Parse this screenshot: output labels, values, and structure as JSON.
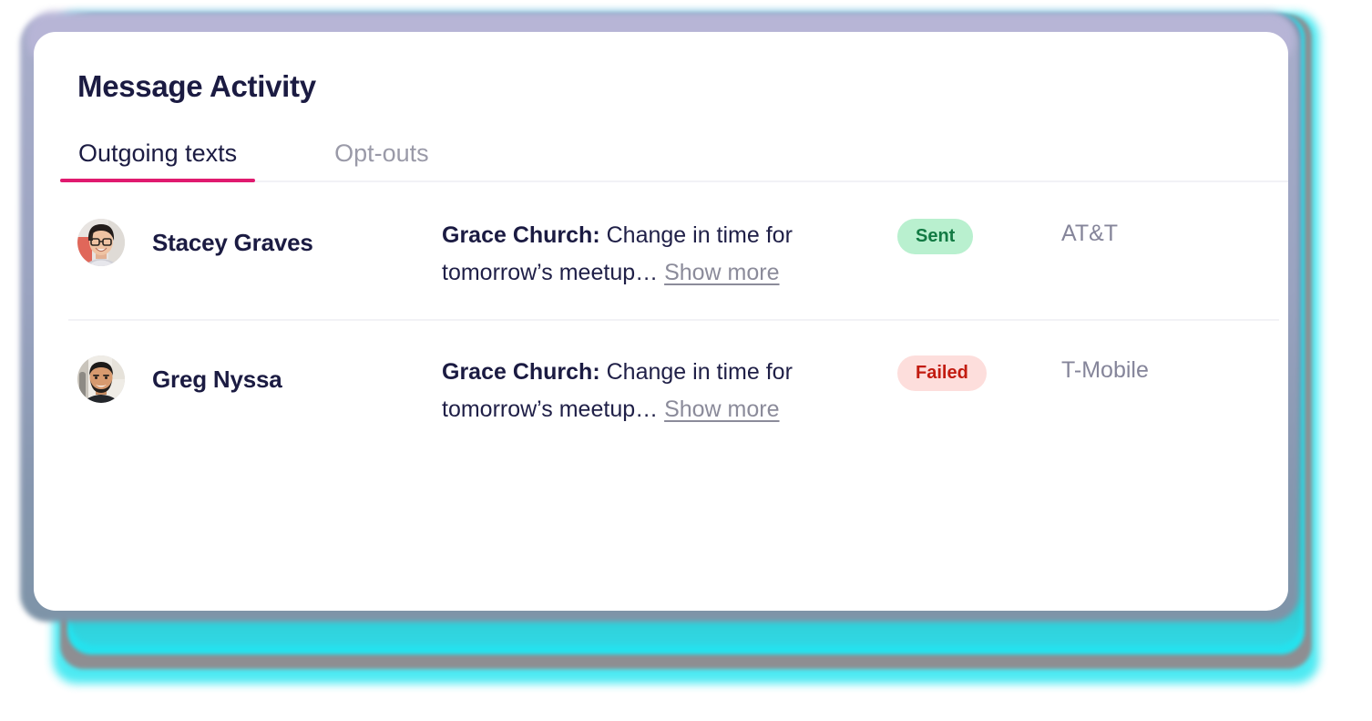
{
  "card": {
    "title": "Message Activity"
  },
  "tabs": [
    {
      "label": "Outgoing texts",
      "active": true
    },
    {
      "label": "Opt-outs",
      "active": false
    }
  ],
  "rows": [
    {
      "name": "Stacey Graves",
      "avatar_alt": "avatar-stacey-graves",
      "message_sender": "Grace Church:",
      "message_body": "Change in time for tomorrow’s meetup…",
      "show_more_label": "Show more",
      "status": "Sent",
      "status_type": "sent",
      "carrier": "AT&T"
    },
    {
      "name": "Greg Nyssa",
      "avatar_alt": "avatar-greg-nyssa",
      "message_sender": "Grace Church:",
      "message_body": "Change in time for tomorrow’s meetup…",
      "show_more_label": "Show more",
      "status": "Failed",
      "status_type": "failed",
      "carrier": "T-Mobile"
    }
  ],
  "colors": {
    "accent": "#e01a6f",
    "title": "#1b1b42",
    "tab_inactive": "#9a9aa8",
    "sent_bg": "#b9f0cf",
    "sent_text": "#127a43",
    "failed_bg": "#fddedc",
    "failed_text": "#c21b10",
    "carrier_text": "#85859a",
    "divider": "#f2f2f6"
  }
}
